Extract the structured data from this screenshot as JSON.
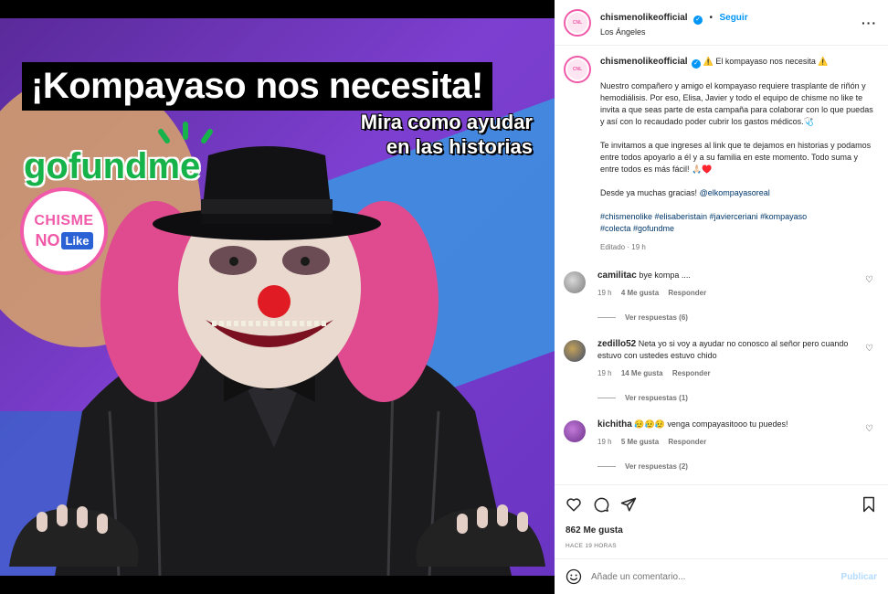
{
  "post_image": {
    "headline": "¡Kompayaso nos necesita!",
    "subline": [
      "Mira como ayudar",
      "en las historias"
    ],
    "gofundme": "gofundme",
    "badge": {
      "top": "CHISME",
      "no": "NO",
      "like": "Like"
    }
  },
  "header": {
    "username": "chismenolikeofficial",
    "separator": "•",
    "follow_label": "Seguir",
    "location": "Los Ángeles",
    "more_icon": "more-icon"
  },
  "caption": {
    "username": "chismenolikeofficial",
    "title": "⚠️ El kompayaso nos necesita ⚠️",
    "p1": "Nuestro compañero y amigo el kompayaso requiere trasplante de riñón y hemodiálisis. Por eso, Elisa, Javier y todo el equipo de chisme no like te invita a que seas parte de esta campaña para colaborar con lo que puedas y así con lo recaudado poder cubrir los gastos médicos.🩺",
    "p2": "Te invitamos a que ingreses al link que te dejamos en historias y podamos entre todos apoyarlo a él y a su familia en este momento. Todo suma y entre todos es más fácil! 🙏🏻♥️",
    "p3_text": "Desde ya muchas gracias! ",
    "p3_mention": "@elkompayasoreal",
    "hashtags_line1": "#chismenolike #elisaberistain #javierceriani #kompayaso",
    "hashtags_line2": "#colecta #gofundme",
    "edited": "Editado · 19 h"
  },
  "comments": [
    {
      "user": "camilitac",
      "text": "bye kompa ....",
      "time": "19 h",
      "likes": "4 Me gusta",
      "reply": "Responder",
      "view_replies": "Ver respuestas (6)"
    },
    {
      "user": "zedillo52",
      "text": "Neta yo si voy a ayudar no conosco al señor pero cuando estuvo con ustedes estuvo chido",
      "time": "19 h",
      "likes": "14 Me gusta",
      "reply": "Responder",
      "view_replies": "Ver respuestas (1)"
    },
    {
      "user": "kichitha",
      "text": "😥😥😥 venga compayasitooo tu puedes!",
      "time": "19 h",
      "likes": "5 Me gusta",
      "reply": "Responder",
      "view_replies": "Ver respuestas (2)"
    }
  ],
  "actions": {
    "likes": "862 Me gusta",
    "ago": "HACE 19 HORAS"
  },
  "add_comment": {
    "placeholder": "Añade un comentario...",
    "post_label": "Publicar"
  },
  "colors": {
    "accent": "#0095f6",
    "brand_pink": "#f05aa8",
    "gofundme_green": "#16b24a"
  }
}
